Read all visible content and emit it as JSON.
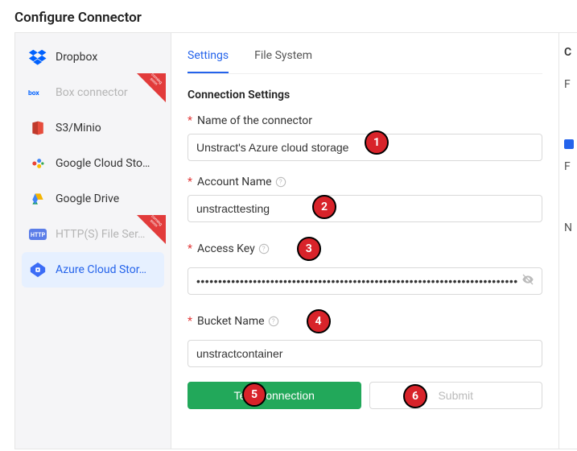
{
  "page": {
    "title": "Configure Connector"
  },
  "sidebar": {
    "items": [
      {
        "label": "Dropbox"
      },
      {
        "label": "Box connector"
      },
      {
        "label": "S3/Minio"
      },
      {
        "label": "Google Cloud Sto…"
      },
      {
        "label": "Google Drive"
      },
      {
        "label": "HTTP(S) File Ser…"
      },
      {
        "label": "Azure Cloud Stor…"
      }
    ]
  },
  "tabs": {
    "settings": "Settings",
    "filesystem": "File System"
  },
  "form": {
    "section_title": "Connection Settings",
    "name_label": "Name of the connector",
    "name_value": "Unstract's Azure cloud storage",
    "account_label": "Account Name",
    "account_value": "unstracttesting",
    "accesskey_label": "Access Key",
    "accesskey_value": "•••••••••••••••••••••••••••••••••••••••••••••••••••••••••••••••••••••••••••••••••••••••",
    "bucket_label": "Bucket Name",
    "bucket_value": "unstractcontainer",
    "test_btn": "Test Connection",
    "submit_btn": "Submit"
  },
  "steps": {
    "s1": "1",
    "s2": "2",
    "s3": "3",
    "s4": "4",
    "s5": "5",
    "s6": "6"
  },
  "right": {
    "title": "C",
    "a": "F",
    "b": "F",
    "c": "N"
  }
}
